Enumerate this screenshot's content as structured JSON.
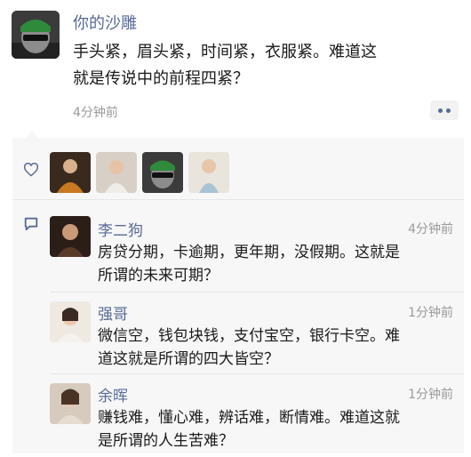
{
  "post": {
    "author": "你的沙雕",
    "text_line1": "手头紧，眉头紧，时间紧，衣服紧。难道这",
    "text_line2": "就是传说中的前程四紧？",
    "time": "4分钟前"
  },
  "likes": {
    "count_shown": 4
  },
  "comments": [
    {
      "name": "李二狗",
      "time": "4分钟前",
      "line1": "房贷分期，卡逾期，更年期，没假期。这就是",
      "line2": "所谓的未来可期？"
    },
    {
      "name": "强哥",
      "time": "1分钟前",
      "line1": "微信空，钱包块钱，支付宝空，银行卡空。难",
      "line2": "道这就是所谓的四大皆空？"
    },
    {
      "name": "余晖",
      "time": "1分钟前",
      "line1": "赚钱难，懂心难，辨话难，断情难。难道这就",
      "line2": "是所谓的人生苦难？"
    }
  ],
  "colors": {
    "name_link": "#576b95",
    "feed_bg": "#f7f7f7",
    "time_gray": "#9a9a9a"
  },
  "icons": {
    "like": "heart-outline-icon",
    "comment": "speech-bubble-icon",
    "more": "more-dots-icon"
  }
}
